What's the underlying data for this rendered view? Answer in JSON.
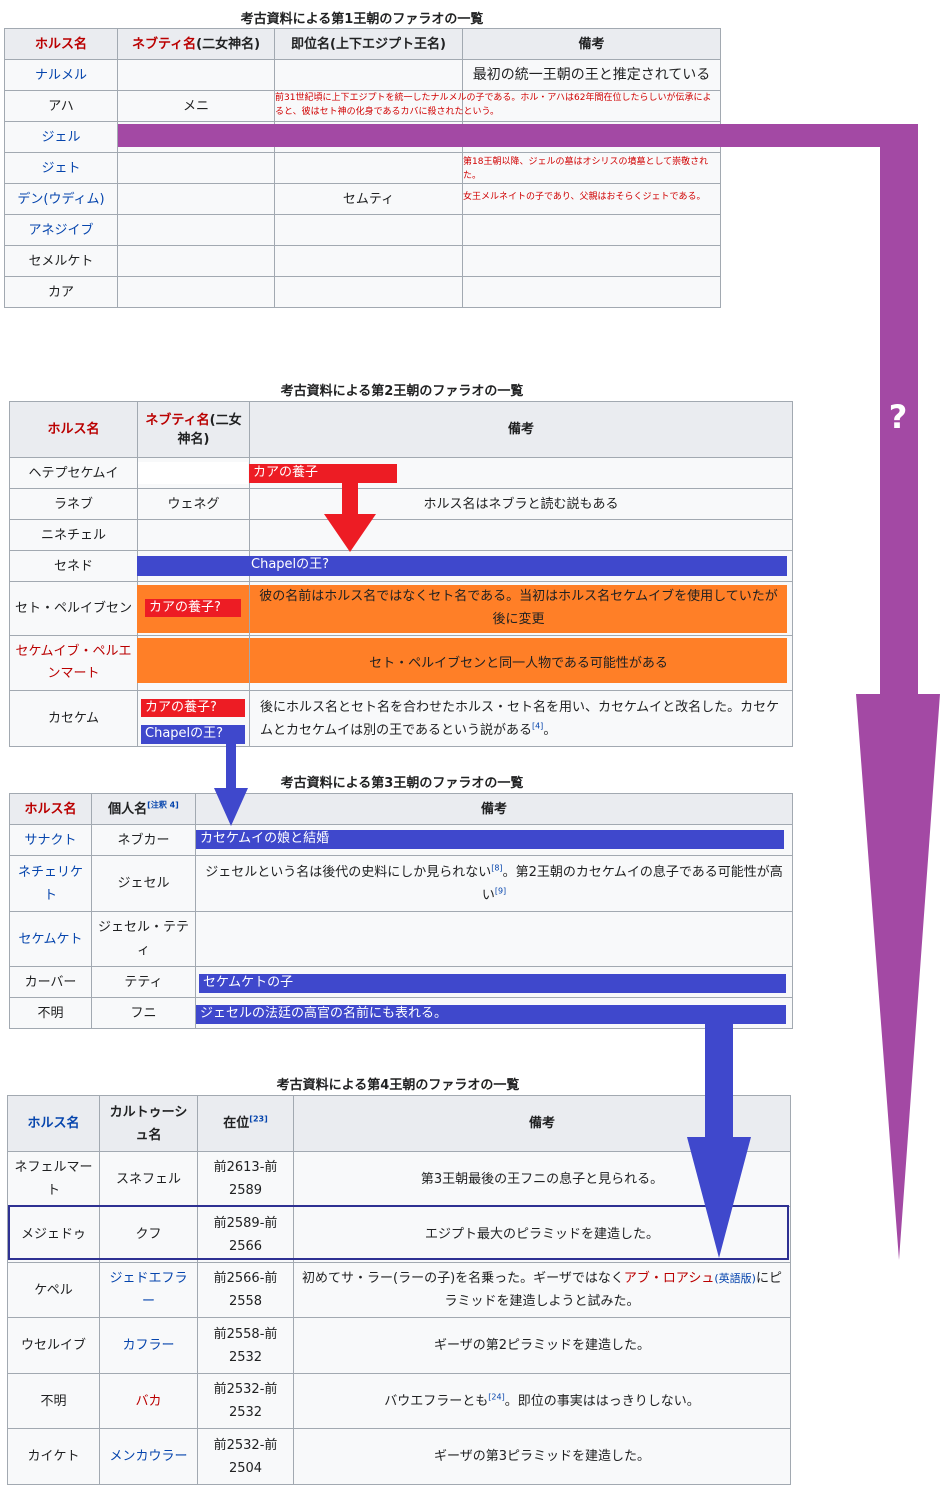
{
  "t1": {
    "caption": "考古資料による第1王朝のファラオの一覧",
    "headers": [
      "ホルス名",
      "ネブティ名",
      "(二女神名)",
      "即位名(上下エジプト王名)",
      "備考"
    ],
    "rows": [
      {
        "horus": "ナルメル",
        "nebty": "",
        "throne": "",
        "note": "最初の統一王朝の王と推定されている"
      },
      {
        "horus": "アハ",
        "nebty": "メニ",
        "throne": "",
        "note": "前31世紀頃に上下エジプトを統一したナルメルの子である。ホル・アハは62年間在位したらしいが伝承によると、彼はセト神の化身であるカバに殺されたという。"
      },
      {
        "horus": "ジェル",
        "nebty": "",
        "throne": "",
        "note": ""
      },
      {
        "horus": "ジェト",
        "nebty": "",
        "throne": "",
        "note": "第18王朝以降、ジェルの墓はオシリスの墳墓として崇敬された。"
      },
      {
        "horus": "デン(ウディム)",
        "nebty": "",
        "throne": "セムティ",
        "note": "女王メルネイトの子であり、父親はおそらくジェトである。"
      },
      {
        "horus": "アネジイブ",
        "nebty": "",
        "throne": "",
        "note": ""
      },
      {
        "horus": "セメルケト",
        "nebty": "",
        "throne": "",
        "note": ""
      },
      {
        "horus": "カア",
        "nebty": "",
        "throne": "",
        "note": ""
      }
    ]
  },
  "t2": {
    "caption": "考古資料による第2王朝のファラオの一覧",
    "headers": [
      "ホルス名",
      "ネブティ名",
      "(二女神名)",
      "備考"
    ],
    "rows": [
      {
        "horus": "ヘテプセケムイ",
        "nebty": "",
        "note": ""
      },
      {
        "horus": "ラネブ",
        "nebty": "ウェネグ",
        "note": "ホルス名はネブラと読む説もある"
      },
      {
        "horus": "ニネチェル",
        "nebty": "",
        "note": ""
      },
      {
        "horus": "セネド",
        "nebty": "",
        "note": ""
      },
      {
        "horus": "セト・ペルイブセン",
        "nebty": "",
        "note": "彼の名前はホルス名ではなくセト名である。当初はホルス名セケムイブを使用していたが後に変更"
      },
      {
        "horus": "セケムイブ・ペルエンマート",
        "nebty": "",
        "note": "セト・ペルイブセンと同一人物である可能性がある"
      },
      {
        "horus": "カセケム",
        "nebty": "",
        "note": "後にホルス名とセト名を合わせたホルス・セト名を用い、カセケムイと改名した。カセケムとカセケムイは別の王であるという説がある",
        "ref": "[4]",
        "tail": "。"
      }
    ]
  },
  "t3": {
    "caption": "考古資料による第3王朝のファラオの一覧",
    "headers": [
      "ホルス名",
      "個人名",
      "備考"
    ],
    "header_ref": "[注釈 4]",
    "rows": [
      {
        "horus": "サナクト",
        "personal": "ネブカー",
        "note": ""
      },
      {
        "horus": "ネチェリケト",
        "personal": "ジェセル",
        "note": "ジェセルという名は後代の史料にしか見られない",
        "ref1": "[8]",
        "mid": "。第2王朝のカセケムイの息子である可能性が高い",
        "ref2": "[9]"
      },
      {
        "horus": "セケムケト",
        "personal": "ジェセル・テティ",
        "note": ""
      },
      {
        "horus": "カーバー",
        "personal": "テティ",
        "note": ""
      },
      {
        "horus": "不明",
        "personal": "フニ",
        "note": ""
      }
    ]
  },
  "t4": {
    "caption": "考古資料による第4王朝のファラオの一覧",
    "headers": [
      "ホルス名",
      "カルトゥーシュ名",
      "在位",
      "備考"
    ],
    "header_ref": "[23]",
    "rows": [
      {
        "horus": "ネフェルマート",
        "cartouche": "スネフェル",
        "reign": "前2613-前2589",
        "note": "第3王朝最後の王フニの息子と見られる。"
      },
      {
        "horus": "メジェドゥ",
        "cartouche": "クフ",
        "reign": "前2589-前2566",
        "note": "エジプト最大のピラミッドを建造した。"
      },
      {
        "horus": "ケペル",
        "cartouche": "ジェドエフラー",
        "reign": "前2566-前2558",
        "note": "初めてサ・ラー(ラーの子)を名乗った。ギーザではなく",
        "link": "アブ・ロアシュ",
        "en": "(英語版)",
        "tail": "にピラミッドを建造しようと試みた。"
      },
      {
        "horus": "ウセルイブ",
        "cartouche": "カフラー",
        "reign": "前2558-前2532",
        "note": "ギーザの第2ピラミッドを建造した。"
      },
      {
        "horus": "不明",
        "cartouche": "バカ",
        "reign": "前2532-前2532",
        "note": "バウエフラーとも",
        "ref": "[24]",
        "tail": "。即位の事実ははっきりしない。"
      },
      {
        "horus": "カイケト",
        "cartouche": "メンカウラー",
        "reign": "前2532-前2504",
        "note": "ギーザの第3ピラミッドを建造した。"
      }
    ]
  },
  "overlay": {
    "kaa_adopted": "カアの養子",
    "kaa_adopted_q": "カアの養子?",
    "chapel_king": "Chapelの王?",
    "married": "カセケムイの娘と結婚",
    "son_sekhemkhet": "セケムケトの子",
    "court_official": "ジェセルの法廷の高官の名前にも表れる。",
    "question": "?"
  },
  "colors": {
    "purple": "#a349a4",
    "blue": "#3f48cc",
    "red": "#ed1c24",
    "orange": "#ff7f27",
    "navy_box": "#2e3192"
  }
}
